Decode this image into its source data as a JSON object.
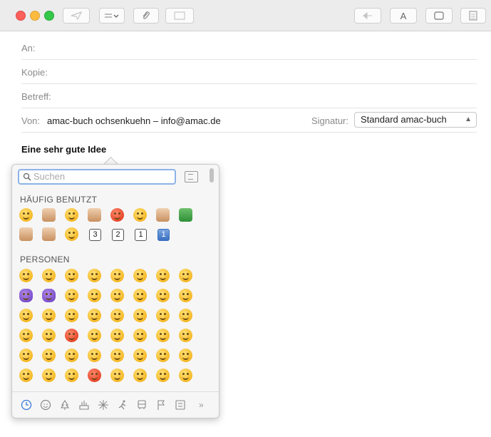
{
  "header": {
    "to_label": "An:",
    "cc_label": "Kopie:",
    "subject_label": "Betreff:",
    "from_label": "Von:",
    "from_value": "amac-buch ochsenkuehn – info@amac.de",
    "signature_label": "Signatur:",
    "signature_value": "Standard amac-buch"
  },
  "toolbar": {
    "format_label": "A"
  },
  "body": {
    "subject_text": "Eine sehr gute Idee"
  },
  "emoji_picker": {
    "search_placeholder": "Suchen",
    "frequently_used_title": "HÄUFIG BENUTZT",
    "people_title": "PERSONEN",
    "keycaps": [
      "3",
      "2",
      "1",
      "1"
    ],
    "categories": [
      "clock-icon",
      "smiley-icon",
      "tree-icon",
      "food-icon",
      "sparkle-icon",
      "runner-icon",
      "bus-icon",
      "flag-icon",
      "symbols-icon"
    ],
    "more_label": "»"
  },
  "colors": {
    "accent": "#8db3e8",
    "close": "#fc605b",
    "minimize": "#fdbc40",
    "zoom": "#34c84a"
  }
}
